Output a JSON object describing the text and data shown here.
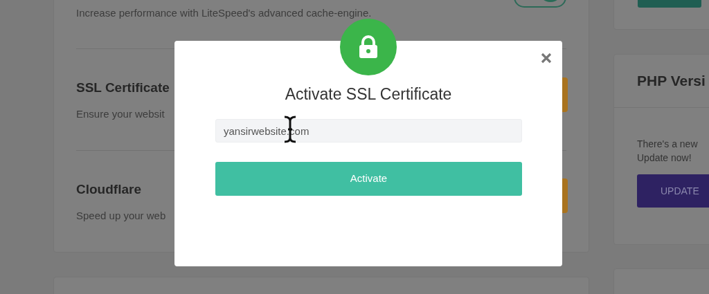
{
  "main_card": {
    "items": [
      {
        "description": "Increase performance with LiteSpeed's advanced cache-engine.",
        "control": {
          "kind": "toggle",
          "on": true
        }
      },
      {
        "title": "SSL Certificate",
        "description": "Ensure your websit",
        "control": {
          "kind": "button"
        }
      },
      {
        "title": "Cloudflare",
        "description": "Speed up your web",
        "control": {
          "kind": "button"
        }
      }
    ]
  },
  "php_card": {
    "title": "PHP Versi",
    "text_lines": [
      "There's a new",
      "Update now!"
    ],
    "button": "UPDATE"
  },
  "modal": {
    "title": "Activate SSL Certificate",
    "domain_field": {
      "value": "yansirwebsite.com"
    },
    "button": "Activate"
  }
}
